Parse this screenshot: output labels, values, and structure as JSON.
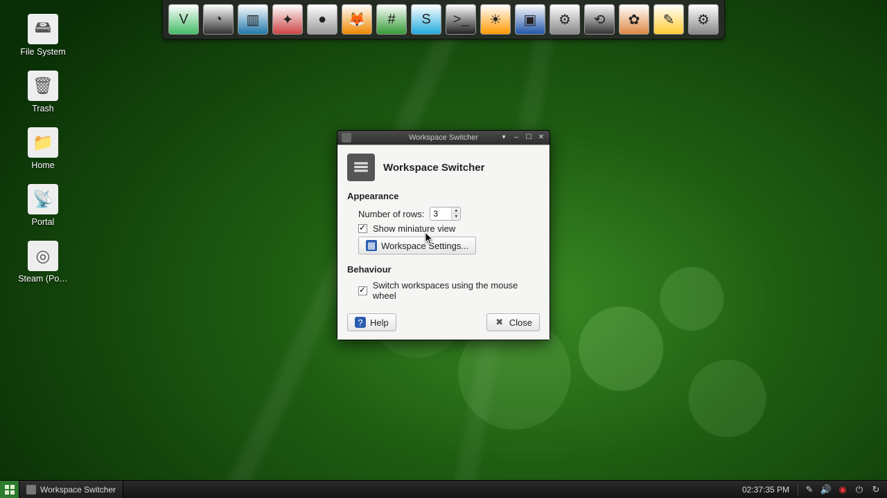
{
  "desktop_icons": [
    {
      "name": "file-system",
      "label": "File System",
      "glyph": "🖴"
    },
    {
      "name": "trash",
      "label": "Trash",
      "glyph": "🗑"
    },
    {
      "name": "home",
      "label": "Home",
      "glyph": "📁"
    },
    {
      "name": "portal",
      "label": "Portal",
      "glyph": "📡"
    },
    {
      "name": "steam",
      "label": "Steam (Po…",
      "glyph": "◎"
    }
  ],
  "dock": [
    "vim",
    "steam",
    "virtualbox",
    "transmission",
    "audio",
    "firefox",
    "hexchat",
    "skype",
    "terminal",
    "clementine",
    "screenshot",
    "settings",
    "python",
    "butterfly",
    "notes",
    "settings-2"
  ],
  "dialog": {
    "titlebar": "Workspace Switcher",
    "heading": "Workspace Switcher",
    "sections": {
      "appearance": {
        "title": "Appearance",
        "rows_label": "Number of rows:",
        "rows_value": "3",
        "miniature_checked": true,
        "miniature_label": "Show miniature view",
        "settings_button": "Workspace Settings..."
      },
      "behaviour": {
        "title": "Behaviour",
        "wheel_checked": true,
        "wheel_label": "Switch workspaces using the mouse wheel"
      }
    },
    "help_label": "Help",
    "close_label": "Close"
  },
  "taskbar": {
    "active_task": "Workspace Switcher",
    "clock": "02:37:35 PM"
  }
}
